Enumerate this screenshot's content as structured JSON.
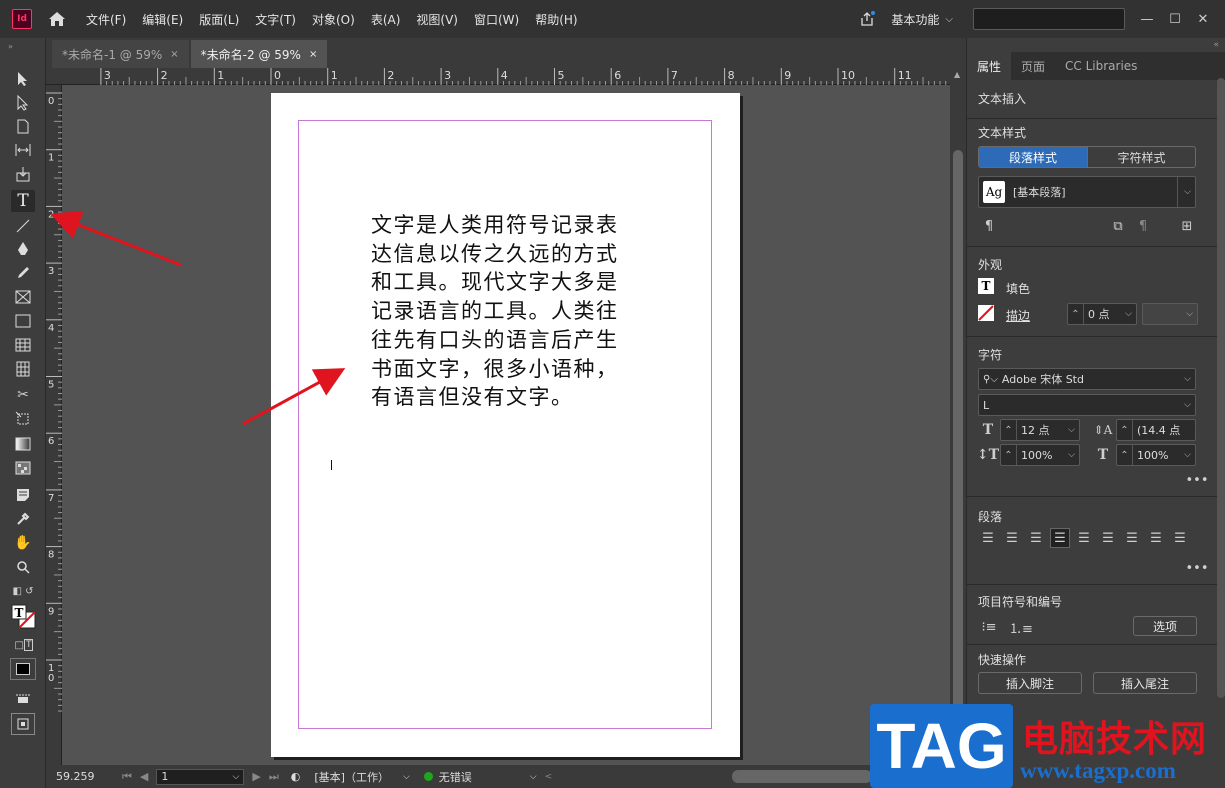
{
  "app": {
    "logo": "Id",
    "workspace": "基本功能"
  },
  "menu": [
    "文件(F)",
    "编辑(E)",
    "版面(L)",
    "文字(T)",
    "对象(O)",
    "表(A)",
    "视图(V)",
    "窗口(W)",
    "帮助(H)"
  ],
  "tabs": [
    {
      "label": "*未命名-1 @ 59%",
      "close": "×"
    },
    {
      "label": "*未命名-2 @ 59%",
      "close": "×"
    }
  ],
  "hruler": [
    "3",
    "2",
    "1",
    "0",
    "1",
    "2",
    "3",
    "4",
    "5",
    "6",
    "7",
    "8",
    "9",
    "10",
    "11"
  ],
  "vruler": [
    "0",
    "1",
    "2",
    "3",
    "4",
    "5",
    "6",
    "7",
    "8",
    "9",
    "1\n0"
  ],
  "document": {
    "lines": [
      "文字是人类用符号记录表",
      "达信息以传之久远的方式",
      "和工具。现代文字大多是",
      "记录语言的工具。人类往",
      "往先有口头的语言后产生",
      "书面文字，很多小语种，",
      "有语言但没有文字。"
    ]
  },
  "status": {
    "zoom": "59.259",
    "page": "1",
    "master": "[基本]（工作）",
    "preflight": "无错误"
  },
  "panel": {
    "tabs": [
      "属性",
      "页面",
      "CC Libraries"
    ],
    "text_insert": "文本插入",
    "text_style": "文本样式",
    "style_tabs": [
      "段落样式",
      "字符样式"
    ],
    "para_style_icon": "Ag",
    "para_style": "[基本段落]",
    "appearance": "外观",
    "fill": "填色",
    "stroke": "描边",
    "stroke_weight": "0 点",
    "character": "字符",
    "font": "Adobe 宋体 Std",
    "font_style": "L",
    "font_size": "12 点",
    "leading": "(14.4 点",
    "vscale": "100%",
    "hscale": "100%",
    "paragraph": "段落",
    "bullets": "项目符号和编号",
    "options": "选项",
    "quick_actions": "快速操作",
    "insert_footnote": "插入脚注",
    "insert_endnote": "插入尾注"
  },
  "watermark": {
    "tag": "TAG",
    "cn": "电脑技术网",
    "url": "www.tagxp.com"
  },
  "colors": {
    "accent": "#2d6bb8",
    "margin_guide": "#c877d6",
    "arrow": "#e0141e"
  }
}
